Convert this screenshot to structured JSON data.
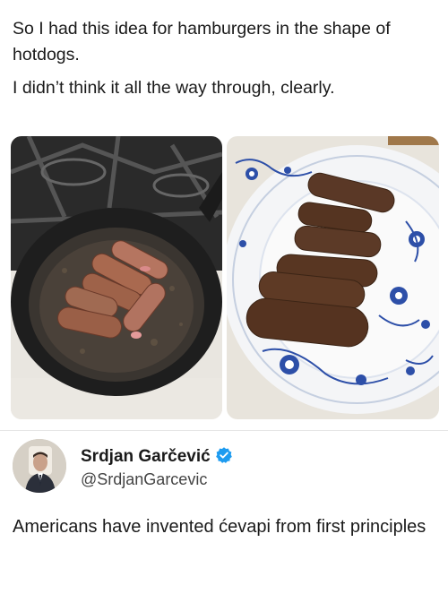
{
  "post": {
    "line1": "So I had this idea for hamburgers in the shape of hotdogs.",
    "line2": "I didn’t think it all the way through, clearly."
  },
  "media": {
    "left_subject": "sausage-shaped burgers cooking in a cast iron skillet on a stove",
    "right_subject": "cooked sausage-shaped burgers on a blue and white patterned plate"
  },
  "reply": {
    "author_name": "Srdjan Garčević",
    "author_handle": "@SrdjanGarcevic",
    "verified": true,
    "text": "Americans have invented ćevapi from first principles",
    "verified_color": "#1d9bf0"
  }
}
